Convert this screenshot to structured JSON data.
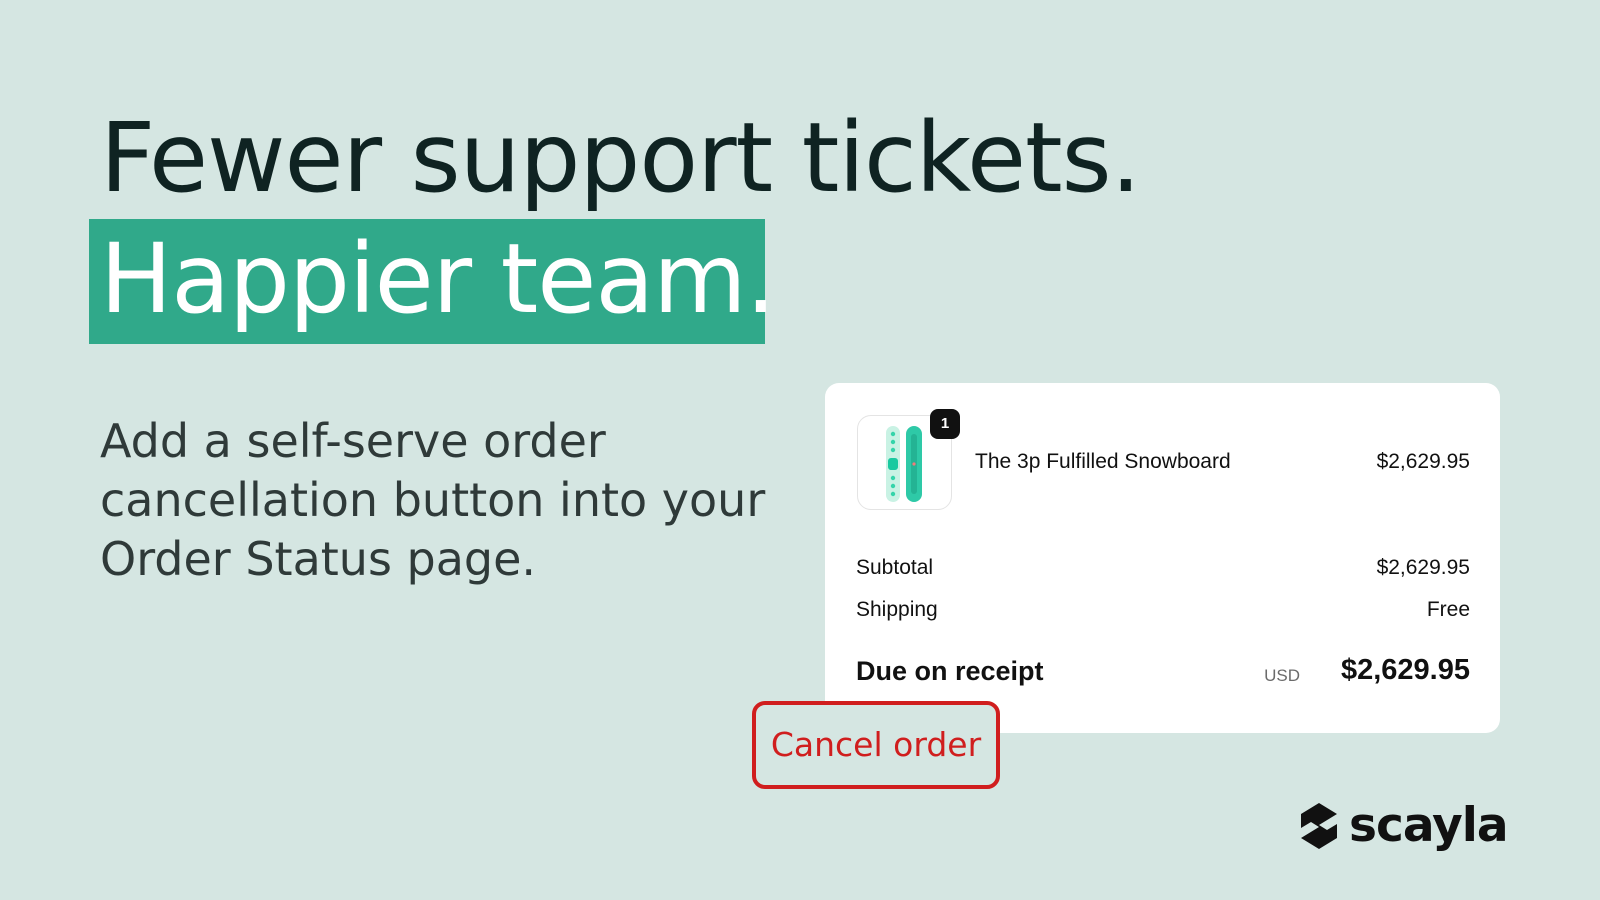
{
  "headline": {
    "line1": "Fewer support tickets.",
    "line2": "Happier team."
  },
  "subcopy": "Add a self-serve order cancellation button into your Order Status page.",
  "order": {
    "item": {
      "name": "The 3p Fulfilled Snowboard",
      "price": "$2,629.95",
      "quantity": "1",
      "image_icon": "snowboard-image"
    },
    "subtotal_label": "Subtotal",
    "subtotal_value": "$2,629.95",
    "shipping_label": "Shipping",
    "shipping_value": "Free",
    "due_label": "Due on receipt",
    "due_currency": "USD",
    "due_total": "$2,629.95"
  },
  "cancel_button": {
    "label": "Cancel order"
  },
  "brand": {
    "name": "scayla",
    "icon": "scayla-logo-icon"
  },
  "colors": {
    "background": "#d5e6e2",
    "accent": "#30a98a",
    "danger": "#d01e1e",
    "ink": "#0f2322"
  }
}
